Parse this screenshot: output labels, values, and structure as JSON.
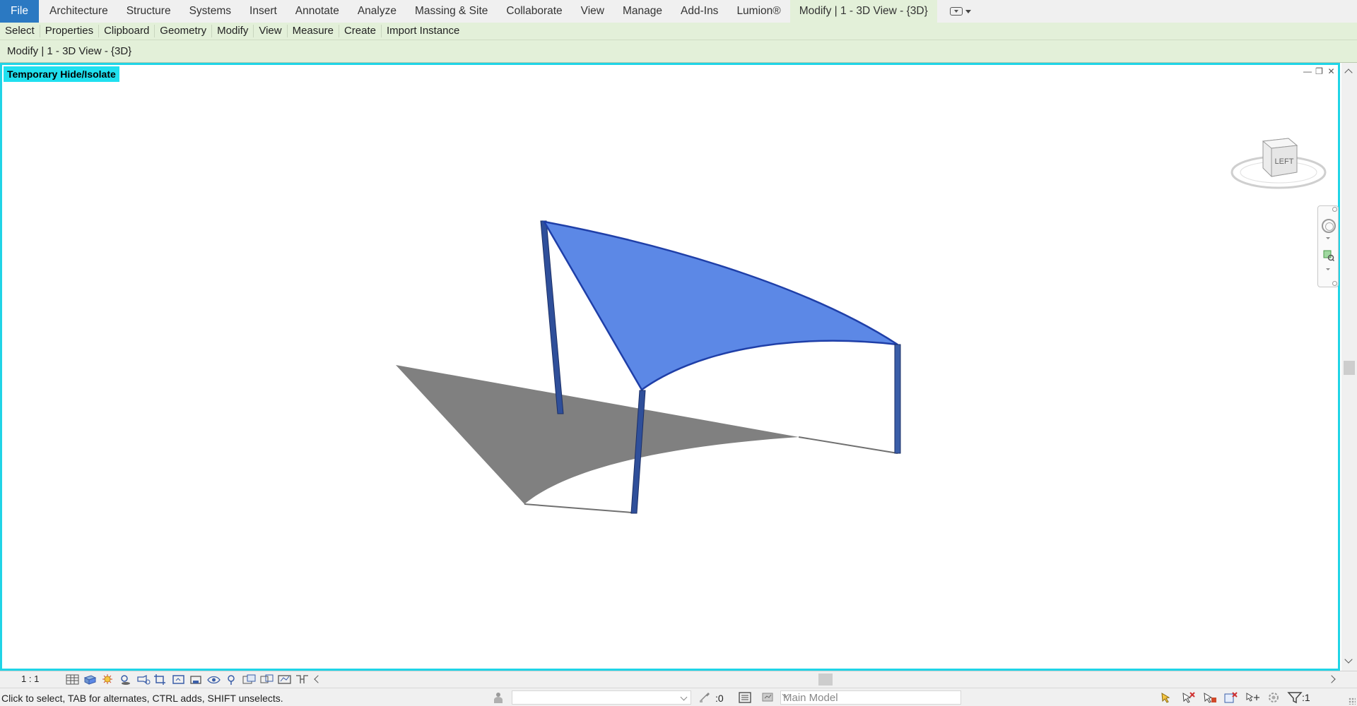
{
  "ribbon": {
    "tabs": [
      {
        "label": "File"
      },
      {
        "label": "Architecture"
      },
      {
        "label": "Structure"
      },
      {
        "label": "Systems"
      },
      {
        "label": "Insert"
      },
      {
        "label": "Annotate"
      },
      {
        "label": "Analyze"
      },
      {
        "label": "Massing & Site"
      },
      {
        "label": "Collaborate"
      },
      {
        "label": "View"
      },
      {
        "label": "Manage"
      },
      {
        "label": "Add-Ins"
      },
      {
        "label": "Lumion®"
      },
      {
        "label": "Modify | 1 - 3D View - {3D}"
      }
    ],
    "panels": [
      "Select",
      "Properties",
      "Clipboard",
      "Geometry",
      "Modify",
      "View",
      "Measure",
      "Create",
      "Import Instance"
    ]
  },
  "options_bar": {
    "label": "Modify | 1 - 3D View - {3D}"
  },
  "view": {
    "mode_banner": "Temporary Hide/Isolate",
    "viewcube_face": "LEFT",
    "colors": {
      "frame": "#20d4e6",
      "canopy": "#5c88e6",
      "column": "#2f4f9a",
      "shadow": "#808080"
    }
  },
  "view_control": {
    "scale": "1 : 1",
    "icons": [
      "detail-level-icon",
      "visual-style-icon",
      "sun-path-icon",
      "shadows-icon",
      "render-icon",
      "crop-view-icon",
      "show-crop-icon",
      "lock-3d-icon",
      "temp-hide-icon",
      "reveal-hidden-icon",
      "temp-properties-icon",
      "analytical-model-icon",
      "highlight-displacement-icon",
      "constraints-icon"
    ]
  },
  "status": {
    "message": "Click to select, TAB for alternates, CTRL adds, SHIFT unselects.",
    "workset_value": "",
    "count": ":0",
    "model": "Main Model",
    "filter_count": ":1"
  }
}
